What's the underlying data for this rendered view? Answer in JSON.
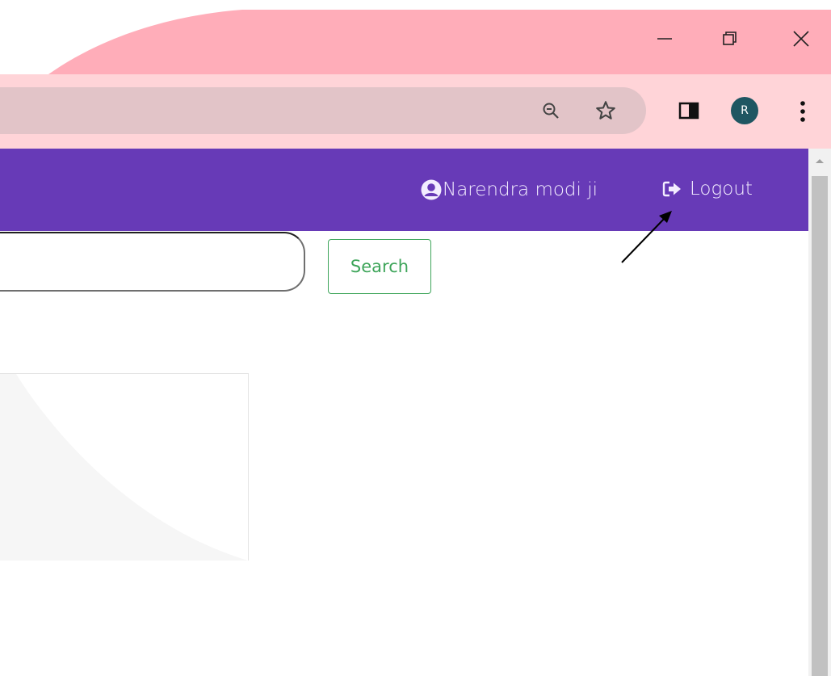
{
  "window_controls": {
    "minimize_icon": "minimize-icon",
    "restore_icon": "restore-icon",
    "close_icon": "close-icon"
  },
  "toolbar": {
    "zoom_icon": "zoom-out-icon",
    "bookmark_icon": "star-icon",
    "side_panel_icon": "side-panel-icon",
    "profile_initial": "R",
    "menu_icon": "kebab-menu-icon"
  },
  "navbar": {
    "user_name": "Narendra modi ji",
    "user_icon": "user-circle-icon",
    "logout_label": "Logout",
    "logout_icon": "logout-icon"
  },
  "search": {
    "value": "",
    "placeholder": "",
    "button_label": "Search"
  },
  "colors": {
    "titlebar": "#ffadb9",
    "toolbar": "#ffd4d8",
    "omnibox": "#e2c4c8",
    "navbar": "#673ab7",
    "search_button": "#3ea55a",
    "avatar": "#1f5662"
  }
}
